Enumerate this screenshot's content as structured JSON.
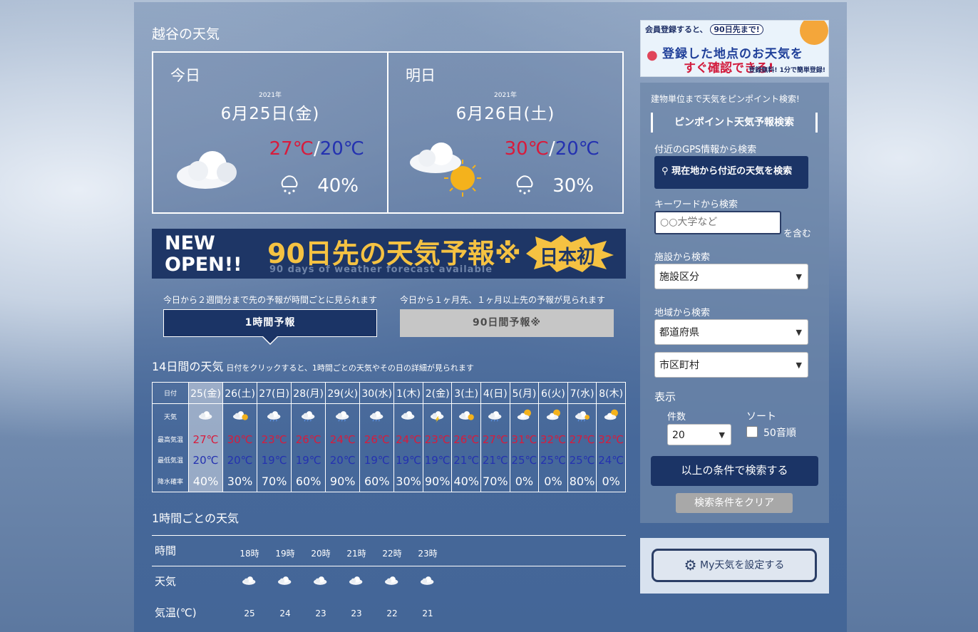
{
  "page_title": "越谷の天気",
  "today": {
    "label": "今日",
    "year": "2021年",
    "date": "6月25日(金)",
    "hi": "27℃",
    "sep": "/",
    "lo": "20℃",
    "rain": "40%",
    "icon": "cloudy-icon"
  },
  "tomorrow": {
    "label": "明日",
    "year": "2021年",
    "date": "6月26日(土)",
    "hi": "30℃",
    "sep": "/",
    "lo": "20℃",
    "rain": "30%",
    "icon": "cloudy-then-sunny-icon"
  },
  "banner": {
    "new": "NEW OPEN!!",
    "title": "90日先の天気予報※",
    "subtitle": "90 days of weather forecast available",
    "badge": "日本初"
  },
  "tabs": [
    {
      "desc": "今日から２週間分まで先の予報が時間ごとに見られます",
      "label": "1時間予報",
      "active": true
    },
    {
      "desc": "今日から１ヶ月先、１ヶ月以上先の予報が見られます",
      "label": "90日間予報※",
      "active": false
    }
  ],
  "days14": {
    "title": "14日間の天気",
    "note": "日付をクリックすると、1時間ごとの天気やその日の詳細が見られます",
    "row_labels": {
      "date": "日付",
      "weather": "天気",
      "hi": "最高気温",
      "lo": "最低気温",
      "rain": "降水確率"
    },
    "days": [
      {
        "date": "25(金)",
        "icon": "cloudy-icon",
        "hi": "27℃",
        "lo": "20℃",
        "rain": "40%"
      },
      {
        "date": "26(土)",
        "icon": "cloudy-sunny-icon",
        "hi": "30℃",
        "lo": "20℃",
        "rain": "30%"
      },
      {
        "date": "27(日)",
        "icon": "cloudy-rain-icon",
        "hi": "23℃",
        "lo": "19℃",
        "rain": "70%"
      },
      {
        "date": "28(月)",
        "icon": "cloudy-rain-icon",
        "hi": "26℃",
        "lo": "19℃",
        "rain": "60%"
      },
      {
        "date": "29(火)",
        "icon": "cloudy-rain-icon",
        "hi": "24℃",
        "lo": "20℃",
        "rain": "90%"
      },
      {
        "date": "30(水)",
        "icon": "cloudy-rain-icon",
        "hi": "26℃",
        "lo": "19℃",
        "rain": "60%"
      },
      {
        "date": "1(木)",
        "icon": "cloudy-icon",
        "hi": "24℃",
        "lo": "19℃",
        "rain": "30%"
      },
      {
        "date": "2(金)",
        "icon": "thunder-rain-icon",
        "hi": "23℃",
        "lo": "19℃",
        "rain": "90%"
      },
      {
        "date": "3(土)",
        "icon": "cloudy-sunny-icon",
        "hi": "26℃",
        "lo": "21℃",
        "rain": "40%"
      },
      {
        "date": "4(日)",
        "icon": "cloudy-rain-icon",
        "hi": "27℃",
        "lo": "21℃",
        "rain": "70%"
      },
      {
        "date": "5(月)",
        "icon": "sunny-cloudy-icon",
        "hi": "31℃",
        "lo": "25℃",
        "rain": "0%"
      },
      {
        "date": "6(火)",
        "icon": "sunny-cloudy-icon",
        "hi": "32℃",
        "lo": "25℃",
        "rain": "0%"
      },
      {
        "date": "7(水)",
        "icon": "cloudy-sunny-rain-icon",
        "hi": "27℃",
        "lo": "25℃",
        "rain": "80%"
      },
      {
        "date": "8(木)",
        "icon": "sunny-cloudy-icon",
        "hi": "32℃",
        "lo": "24℃",
        "rain": "0%"
      }
    ]
  },
  "hourly": {
    "title": "1時間ごとの天気",
    "row_labels": {
      "time": "時間",
      "weather": "天気",
      "temp": "気温(℃)"
    },
    "hours": [
      {
        "time": "18時",
        "icon": "cloudy-icon",
        "temp": "25"
      },
      {
        "time": "19時",
        "icon": "cloudy-icon",
        "temp": "24"
      },
      {
        "time": "20時",
        "icon": "cloudy-icon",
        "temp": "23"
      },
      {
        "time": "21時",
        "icon": "cloudy-icon",
        "temp": "23"
      },
      {
        "time": "22時",
        "icon": "cloudy-icon",
        "temp": "22"
      },
      {
        "time": "23時",
        "icon": "cloudy-icon",
        "temp": "21"
      }
    ]
  },
  "sidebar": {
    "ad": {
      "line1": "会員登録すると、",
      "badge": "90日先まで!",
      "line2": "登録した地点のお天気を",
      "line3": "すぐ確認できる!",
      "footer": "登録無料! 1分で簡単登録!"
    },
    "intro": "建物単位まで天気をピンポイント検索!",
    "heading": "ピンポイント天気予報検索",
    "gps_label": "付近のGPS情報から検索",
    "gps_button": "現在地から付近の天気を検索",
    "keyword_label": "キーワードから検索",
    "keyword_placeholder": "○○大学など",
    "keyword_suffix": "を含む",
    "facility_label": "施設から検索",
    "facility_select": "施設区分",
    "region_label": "地域から検索",
    "pref_select": "都道府県",
    "city_select": "市区町村",
    "display_label": "表示",
    "count_label": "件数",
    "count_value": "20",
    "sort_label": "ソート",
    "sort_option": "50音順",
    "search_button": "以上の条件で検索する",
    "clear_button": "検索条件をクリア",
    "my_weather_button": "My天気を設定する"
  },
  "colors": {
    "hi": "#d81b3c",
    "lo": "#2432b0",
    "navy": "#1b3466"
  }
}
